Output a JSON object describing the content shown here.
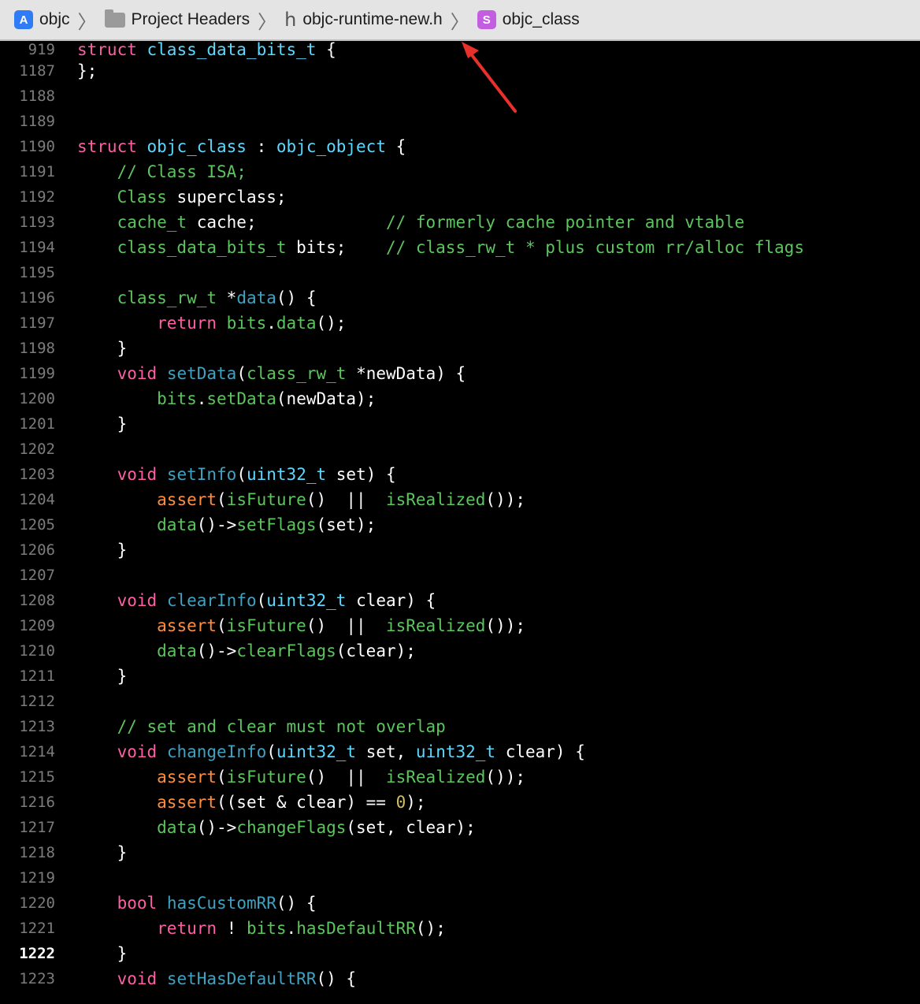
{
  "breadcrumb": {
    "project": "objc",
    "group": "Project Headers",
    "file": "objc-runtime-new.h",
    "symbol_badge": "S",
    "symbol": "objc_class"
  },
  "current_line": "1222",
  "lines": [
    {
      "n": "919",
      "t": [
        [
          "kw",
          "struct "
        ],
        [
          "ty",
          "class_data_bits_t"
        ],
        [
          "txt",
          " {"
        ]
      ]
    },
    {
      "n": "1187",
      "t": [
        [
          "txt",
          "};"
        ]
      ]
    },
    {
      "n": "1188",
      "t": []
    },
    {
      "n": "1189",
      "t": []
    },
    {
      "n": "1190",
      "t": [
        [
          "kw",
          "struct "
        ],
        [
          "ty",
          "objc_class"
        ],
        [
          "txt",
          " : "
        ],
        [
          "ty",
          "objc_object"
        ],
        [
          "txt",
          " {"
        ]
      ]
    },
    {
      "n": "1191",
      "t": [
        [
          "txt",
          "    "
        ],
        [
          "cm2",
          "// Class ISA;"
        ]
      ]
    },
    {
      "n": "1192",
      "t": [
        [
          "txt",
          "    "
        ],
        [
          "cm2",
          "Class"
        ],
        [
          "txt",
          " superclass;"
        ]
      ]
    },
    {
      "n": "1193",
      "t": [
        [
          "txt",
          "    "
        ],
        [
          "cm2",
          "cache_t"
        ],
        [
          "txt",
          " cache;             "
        ],
        [
          "cm2",
          "// formerly cache pointer and vtable"
        ]
      ]
    },
    {
      "n": "1194",
      "t": [
        [
          "txt",
          "    "
        ],
        [
          "cm2",
          "class_data_bits_t"
        ],
        [
          "txt",
          " bits;    "
        ],
        [
          "cm2",
          "// class_rw_t * plus custom rr/alloc flags"
        ]
      ]
    },
    {
      "n": "1195",
      "t": []
    },
    {
      "n": "1196",
      "t": [
        [
          "txt",
          "    "
        ],
        [
          "cm2",
          "class_rw_t"
        ],
        [
          "txt",
          " *"
        ],
        [
          "fn",
          "data"
        ],
        [
          "txt",
          "() {"
        ]
      ]
    },
    {
      "n": "1197",
      "t": [
        [
          "txt",
          "        "
        ],
        [
          "kw",
          "return"
        ],
        [
          "txt",
          " "
        ],
        [
          "cm2",
          "bits"
        ],
        [
          "txt",
          "."
        ],
        [
          "cm2",
          "data"
        ],
        [
          "txt",
          "();"
        ]
      ]
    },
    {
      "n": "1198",
      "t": [
        [
          "txt",
          "    }"
        ]
      ]
    },
    {
      "n": "1199",
      "t": [
        [
          "txt",
          "    "
        ],
        [
          "kw",
          "void"
        ],
        [
          "txt",
          " "
        ],
        [
          "fn",
          "setData"
        ],
        [
          "txt",
          "("
        ],
        [
          "cm2",
          "class_rw_t"
        ],
        [
          "txt",
          " *newData) {"
        ]
      ]
    },
    {
      "n": "1200",
      "t": [
        [
          "txt",
          "        "
        ],
        [
          "cm2",
          "bits"
        ],
        [
          "txt",
          "."
        ],
        [
          "cm2",
          "setData"
        ],
        [
          "txt",
          "(newData);"
        ]
      ]
    },
    {
      "n": "1201",
      "t": [
        [
          "txt",
          "    }"
        ]
      ]
    },
    {
      "n": "1202",
      "t": []
    },
    {
      "n": "1203",
      "t": [
        [
          "txt",
          "    "
        ],
        [
          "kw",
          "void"
        ],
        [
          "txt",
          " "
        ],
        [
          "fn",
          "setInfo"
        ],
        [
          "txt",
          "("
        ],
        [
          "ty",
          "uint32_t"
        ],
        [
          "txt",
          " set) {"
        ]
      ]
    },
    {
      "n": "1204",
      "t": [
        [
          "txt",
          "        "
        ],
        [
          "mc",
          "assert"
        ],
        [
          "txt",
          "("
        ],
        [
          "cm2",
          "isFuture"
        ],
        [
          "txt",
          "()  ||  "
        ],
        [
          "cm2",
          "isRealized"
        ],
        [
          "txt",
          "());"
        ]
      ]
    },
    {
      "n": "1205",
      "t": [
        [
          "txt",
          "        "
        ],
        [
          "cm2",
          "data"
        ],
        [
          "txt",
          "()->"
        ],
        [
          "cm2",
          "setFlags"
        ],
        [
          "txt",
          "(set);"
        ]
      ]
    },
    {
      "n": "1206",
      "t": [
        [
          "txt",
          "    }"
        ]
      ]
    },
    {
      "n": "1207",
      "t": []
    },
    {
      "n": "1208",
      "t": [
        [
          "txt",
          "    "
        ],
        [
          "kw",
          "void"
        ],
        [
          "txt",
          " "
        ],
        [
          "fn",
          "clearInfo"
        ],
        [
          "txt",
          "("
        ],
        [
          "ty",
          "uint32_t"
        ],
        [
          "txt",
          " clear) {"
        ]
      ]
    },
    {
      "n": "1209",
      "t": [
        [
          "txt",
          "        "
        ],
        [
          "mc",
          "assert"
        ],
        [
          "txt",
          "("
        ],
        [
          "cm2",
          "isFuture"
        ],
        [
          "txt",
          "()  ||  "
        ],
        [
          "cm2",
          "isRealized"
        ],
        [
          "txt",
          "());"
        ]
      ]
    },
    {
      "n": "1210",
      "t": [
        [
          "txt",
          "        "
        ],
        [
          "cm2",
          "data"
        ],
        [
          "txt",
          "()->"
        ],
        [
          "cm2",
          "clearFlags"
        ],
        [
          "txt",
          "(clear);"
        ]
      ]
    },
    {
      "n": "1211",
      "t": [
        [
          "txt",
          "    }"
        ]
      ]
    },
    {
      "n": "1212",
      "t": []
    },
    {
      "n": "1213",
      "t": [
        [
          "txt",
          "    "
        ],
        [
          "cm2",
          "// set and clear must not overlap"
        ]
      ]
    },
    {
      "n": "1214",
      "t": [
        [
          "txt",
          "    "
        ],
        [
          "kw",
          "void"
        ],
        [
          "txt",
          " "
        ],
        [
          "fn",
          "changeInfo"
        ],
        [
          "txt",
          "("
        ],
        [
          "ty",
          "uint32_t"
        ],
        [
          "txt",
          " set, "
        ],
        [
          "ty",
          "uint32_t"
        ],
        [
          "txt",
          " clear) {"
        ]
      ]
    },
    {
      "n": "1215",
      "t": [
        [
          "txt",
          "        "
        ],
        [
          "mc",
          "assert"
        ],
        [
          "txt",
          "("
        ],
        [
          "cm2",
          "isFuture"
        ],
        [
          "txt",
          "()  ||  "
        ],
        [
          "cm2",
          "isRealized"
        ],
        [
          "txt",
          "());"
        ]
      ]
    },
    {
      "n": "1216",
      "t": [
        [
          "txt",
          "        "
        ],
        [
          "mc",
          "assert"
        ],
        [
          "txt",
          "((set & clear) == "
        ],
        [
          "nm",
          "0"
        ],
        [
          "txt",
          ");"
        ]
      ]
    },
    {
      "n": "1217",
      "t": [
        [
          "txt",
          "        "
        ],
        [
          "cm2",
          "data"
        ],
        [
          "txt",
          "()->"
        ],
        [
          "cm2",
          "changeFlags"
        ],
        [
          "txt",
          "(set, clear);"
        ]
      ]
    },
    {
      "n": "1218",
      "t": [
        [
          "txt",
          "    }"
        ]
      ]
    },
    {
      "n": "1219",
      "t": []
    },
    {
      "n": "1220",
      "t": [
        [
          "txt",
          "    "
        ],
        [
          "kw",
          "bool"
        ],
        [
          "txt",
          " "
        ],
        [
          "fn",
          "hasCustomRR"
        ],
        [
          "txt",
          "() {"
        ]
      ]
    },
    {
      "n": "1221",
      "t": [
        [
          "txt",
          "        "
        ],
        [
          "kw",
          "return"
        ],
        [
          "txt",
          " ! "
        ],
        [
          "cm2",
          "bits"
        ],
        [
          "txt",
          "."
        ],
        [
          "cm2",
          "hasDefaultRR"
        ],
        [
          "txt",
          "();"
        ]
      ]
    },
    {
      "n": "1222",
      "t": [
        [
          "txt",
          "    }"
        ]
      ]
    },
    {
      "n": "1223",
      "t": [
        [
          "txt",
          "    "
        ],
        [
          "kw",
          "void"
        ],
        [
          "txt",
          " "
        ],
        [
          "fn",
          "setHasDefaultRR"
        ],
        [
          "txt",
          "() {"
        ]
      ]
    }
  ],
  "colors": {
    "background": "#000000",
    "keyword": "#fc5fa3",
    "type": "#5dd8ff",
    "function": "#41a1c0",
    "project_symbol": "#5dc45f",
    "macro": "#fd8f3f",
    "number": "#d0bf69",
    "annotation_arrow": "#e8312a"
  }
}
